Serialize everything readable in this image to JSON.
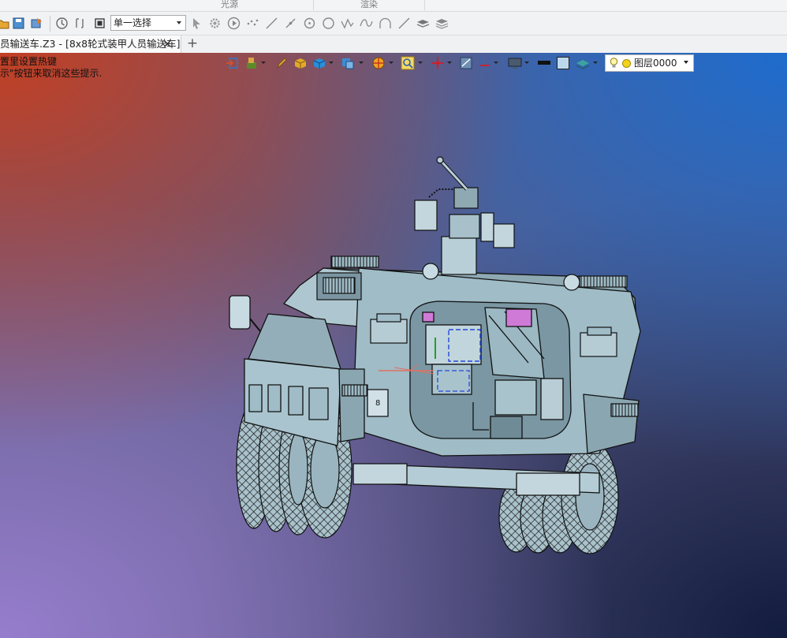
{
  "ribbon": {
    "group_labels": [
      "光源",
      "渲染"
    ]
  },
  "toolbar": {
    "selection_mode": "单一选择",
    "icons": [
      "open-folder-icon",
      "save-icon",
      "export-icon",
      "history-icon",
      "filter-icon",
      "stop-icon",
      "pointer-icon",
      "gear-select-icon",
      "play-icon",
      "points-icon",
      "line-icon",
      "segment-icon",
      "circle-center-icon",
      "circle-icon",
      "polyline-icon",
      "spline-icon",
      "arc-icon",
      "line-angle-icon",
      "layer-stack-icon",
      "layer-visibility-icon"
    ]
  },
  "tabs": {
    "document": "员输送车.Z3 - [8x8轮式装甲人员输送车]",
    "close_symbol": "✕",
    "new_tab_symbol": "+"
  },
  "viewport": {
    "hint_lines": [
      "置里设置热键",
      "示\"按钮来取消这些提示."
    ],
    "view_toolbar": [
      "exit-icon",
      "component-icon",
      "pencil-icon",
      "shaded-box-icon",
      "wireframe-box-icon",
      "view-orient-icon",
      "render-mode-icon",
      "zoom-search-icon",
      "move-axis-icon",
      "measure-icon",
      "section-icon",
      "display-icon",
      "color-black-swatch",
      "color-lightblue-swatch",
      "layer-stack-icon"
    ],
    "layer_dropdown": "图层0000",
    "model": {
      "hull_number": "8"
    }
  },
  "colors": {
    "hull": "#9fbcc7",
    "edge": "#1a1a1a",
    "bg_top_left": "#c83e1e",
    "bg_top_right": "#1e6ccd",
    "bg_bottom_left": "#967dcd",
    "bg_bottom_right": "#121c3e"
  }
}
